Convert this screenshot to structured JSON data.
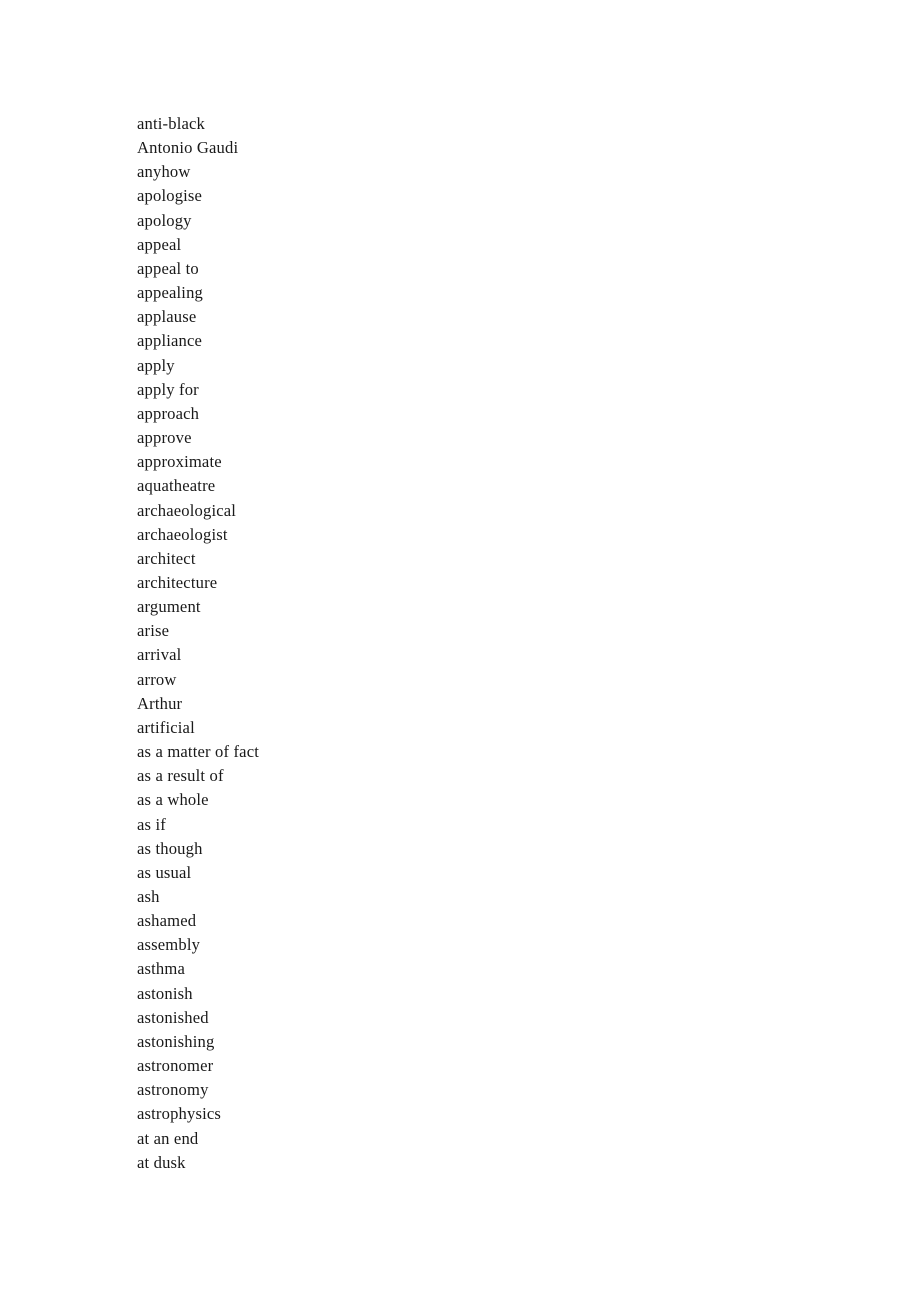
{
  "document": {
    "kind": "word-list",
    "background_color": "#ffffff",
    "text_color": "#1a1a1a",
    "entry_count": 44
  },
  "wordlist": {
    "entries": [
      {
        "text": "anti-black"
      },
      {
        "text": "Antonio Gaudi"
      },
      {
        "text": "anyhow"
      },
      {
        "text": "apologise"
      },
      {
        "text": "apology"
      },
      {
        "text": "appeal"
      },
      {
        "text": "appeal to"
      },
      {
        "text": "appealing"
      },
      {
        "text": "applause"
      },
      {
        "text": "appliance"
      },
      {
        "text": "apply"
      },
      {
        "text": "apply for"
      },
      {
        "text": "approach"
      },
      {
        "text": "approve"
      },
      {
        "text": "approximate"
      },
      {
        "text": "aquatheatre"
      },
      {
        "text": "archaeological"
      },
      {
        "text": "archaeologist"
      },
      {
        "text": "architect"
      },
      {
        "text": "architecture"
      },
      {
        "text": "argument"
      },
      {
        "text": "arise"
      },
      {
        "text": "arrival"
      },
      {
        "text": "arrow"
      },
      {
        "text": "Arthur"
      },
      {
        "text": "artificial"
      },
      {
        "text": "as a matter of fact"
      },
      {
        "text": "as a result of"
      },
      {
        "text": "as a whole"
      },
      {
        "text": "as if"
      },
      {
        "text": "as though"
      },
      {
        "text": "as usual"
      },
      {
        "text": "ash"
      },
      {
        "text": "ashamed"
      },
      {
        "text": "assembly"
      },
      {
        "text": "asthma"
      },
      {
        "text": "astonish"
      },
      {
        "text": "astonished"
      },
      {
        "text": "astonishing"
      },
      {
        "text": "astronomer"
      },
      {
        "text": "astronomy"
      },
      {
        "text": "astrophysics"
      },
      {
        "text": "at an end"
      },
      {
        "text": "at dusk"
      }
    ]
  }
}
